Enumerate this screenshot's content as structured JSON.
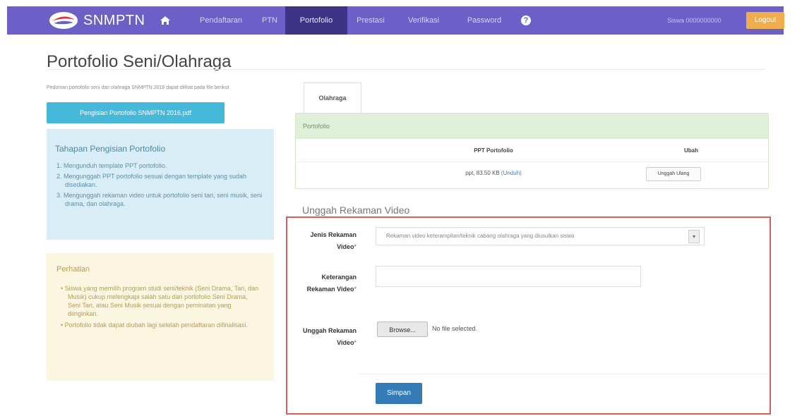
{
  "navbar": {
    "brand": "SNMPTN",
    "items": [
      {
        "label": "Pendaftaran",
        "active": false
      },
      {
        "label": "PTN",
        "active": false
      },
      {
        "label": "Portofolio",
        "active": true
      },
      {
        "label": "Prestasi",
        "active": false
      },
      {
        "label": "Verifikasi",
        "active": false
      },
      {
        "label": "Password",
        "active": false
      }
    ],
    "user": "Siswa 0000000000",
    "logout_label": "Logout",
    "colors": {
      "bar": "#6c5fc7",
      "active": "#3d3488",
      "logout": "#f0ad4e"
    }
  },
  "page": {
    "title": "Portofolio Seni/Olahraga"
  },
  "sidebar": {
    "intro": "Pedoman portofolio seni dan olahraga SNMPTN 2016 dapat dilihat pada file berikut",
    "download_label": "Pengisian Portofolio SNMPTN 2016.pdf",
    "steps_title": "Tahapan Pengisian Portofolio",
    "steps": [
      "1. Mengunduh template PPT portofolio.",
      "2. Mengunggah PPT portofolio sesuai dengan template yang sudah disediakan.",
      "3. Mengunggah rekaman video untuk portofolio seni tari, seni musik, seni drama, dan olahraga."
    ],
    "notice_title": "Perhatian",
    "notices": [
      "• Siswa yang memilih program studi seni/teknik (Seni Drama, Tari, dan Musik) cukup melengkapi salah satu dari portofolio Seni Drama, Seni Tari, atau Seni Musik sesuai dengan peminatan yang diinginkan.",
      "• Portofolio tidak dapat diubah lagi setelah pendaftaran difinalisasi."
    ],
    "colors": {
      "info_bg": "#d9edf7",
      "warn_bg": "#fcf6e1",
      "download_bg": "#46b8da"
    }
  },
  "main": {
    "tab_label": "Olahraga",
    "panel": {
      "heading": "Portofolio",
      "col_file": "PPT Portofolio",
      "col_action": "Ubah",
      "file_info": "ppt, 83.50 KB",
      "download_link": "(Unduh)",
      "reupload_label": "Unggah Ulang"
    },
    "video_section": {
      "title": "Unggah Rekaman Video",
      "type_label": "Jenis Rekaman Video",
      "type_value": "Rekaman video keterampilan/teknik cabang olahraga yang diusulkan siswa",
      "desc_label": "Keterangan Rekaman Video",
      "desc_value": "",
      "upload_label": "Unggah Rekaman Video",
      "browse_label": "Browse...",
      "file_status": "No file selected.",
      "required_mark": "*",
      "save_label": "Simpan"
    },
    "colors": {
      "highlight_border": "#e05a5a",
      "panel_heading": "#dff0d8",
      "save_button": "#337ab7"
    }
  }
}
